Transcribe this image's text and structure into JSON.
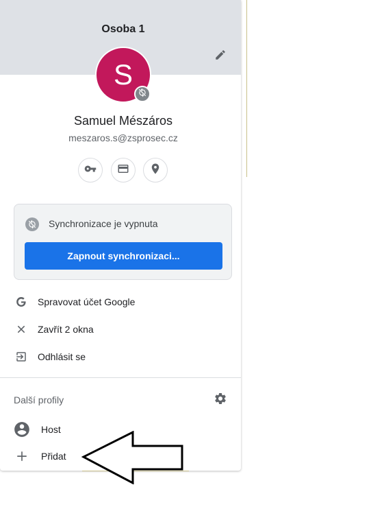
{
  "profile": {
    "title": "Osoba 1",
    "avatar_letter": "S",
    "avatar_color": "#c2185b",
    "name": "Samuel Mészáros",
    "email": "meszaros.s@zsprosec.cz"
  },
  "quick_actions": [
    {
      "icon": "key-icon"
    },
    {
      "icon": "credit-card-icon"
    },
    {
      "icon": "location-pin-icon"
    }
  ],
  "sync": {
    "status_text": "Synchronizace je vypnuta",
    "button_label": "Zapnout synchronizaci...",
    "button_color": "#1a73e8"
  },
  "menu": {
    "manage_account": "Spravovat účet Google",
    "close_windows": "Zavřít 2 okna",
    "sign_out": "Odhlásit se"
  },
  "other_profiles": {
    "heading": "Další profily",
    "guest_label": "Host",
    "add_label": "Přidat"
  },
  "annotation": {
    "arrow": "left-pointing-arrow"
  }
}
